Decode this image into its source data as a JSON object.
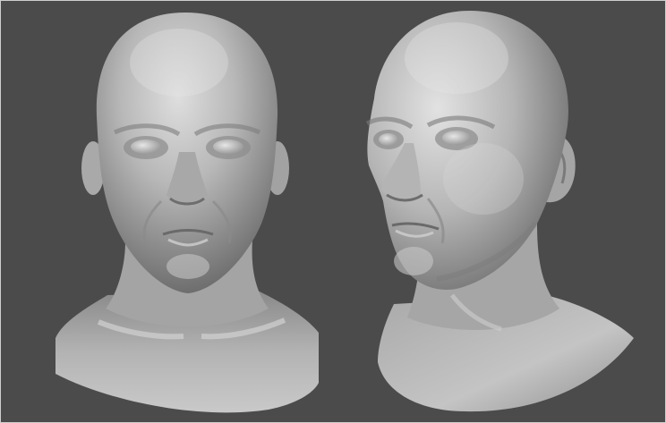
{
  "scene": {
    "background_color": "#4b4b4b",
    "material_color": "#b9b9b9",
    "subjects": [
      {
        "name": "head-front-view",
        "view": "front"
      },
      {
        "name": "head-three-quarter-view",
        "view": "three-quarter"
      }
    ]
  }
}
